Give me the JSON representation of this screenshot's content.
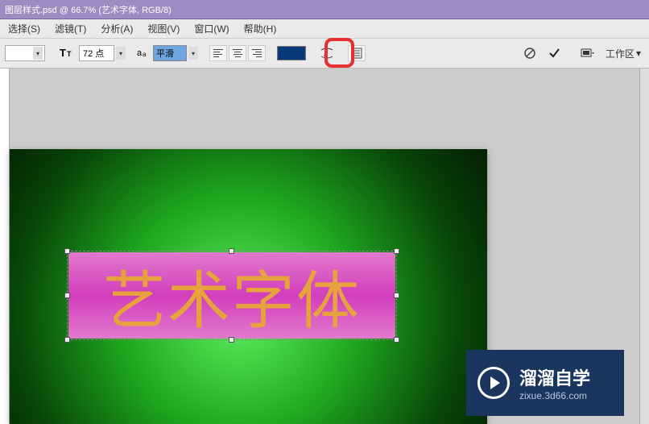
{
  "title": "图层样式.psd @ 66.7% (艺术字体, RGB/8)",
  "menu": {
    "select": "选择(S)",
    "filter": "滤镜(T)",
    "analysis": "分析(A)",
    "view": "视图(V)",
    "window": "窗口(W)",
    "help": "帮助(H)"
  },
  "options": {
    "font_size": "72 点",
    "aa_mode": "平滑",
    "text_color": "#083a7a",
    "workspace": "工作区"
  },
  "canvas": {
    "art_text": "艺术字体"
  },
  "watermark": {
    "title": "溜溜自学",
    "url": "zixue.3d66.com"
  }
}
